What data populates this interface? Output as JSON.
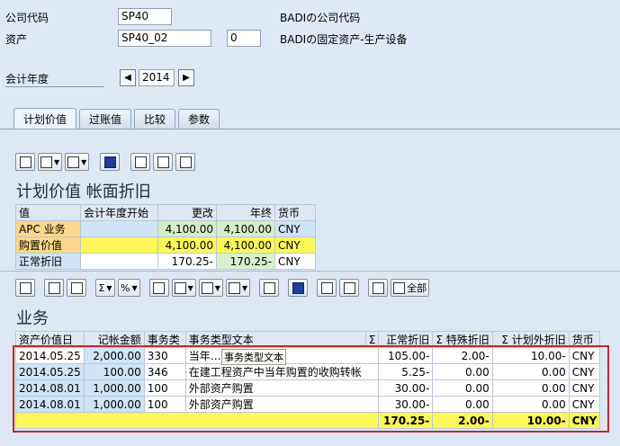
{
  "header": {
    "company_label": "公司代码",
    "company_value": "SP40",
    "company_badi": "BADIの公司代码",
    "asset_label": "资产",
    "asset_value": "SP40_02",
    "asset_sub": "0",
    "asset_badi": "BADIの固定资产-生产设备",
    "fy_label": "会计年度",
    "fy_value": "2014"
  },
  "tabs": [
    "计划价值",
    "过账值",
    "比较",
    "参数"
  ],
  "valuation": {
    "title": "计划价值 帐面折旧",
    "columns": [
      "值",
      "会计年度开始",
      "更改",
      "年终",
      "货币"
    ],
    "rows": [
      [
        "APC 业务",
        "",
        "4,100.00",
        "4,100.00",
        "CNY"
      ],
      [
        "购置价值",
        "",
        "4,100.00",
        "4,100.00",
        "CNY"
      ],
      [
        "正常折旧",
        "",
        "170.25-",
        "170.25-",
        "CNY"
      ]
    ]
  },
  "toolbar2": {
    "all_label": "全部"
  },
  "transactions": {
    "title": "业务",
    "columns": [
      "资产价值日",
      "记帐金额",
      "事务类",
      "事务类型文本",
      "Σ",
      "正常折旧",
      "Σ 特殊折旧",
      "Σ 计划外折旧",
      "货币"
    ],
    "rows": [
      [
        "2014.05.25",
        "2,000.00",
        "330",
        "当年…",
        "105.00-",
        "2.00-",
        "10.00-",
        "CNY"
      ],
      [
        "2014.05.25",
        "100.00",
        "346",
        "在建工程资产中当年购置的收购转帐",
        "5.25-",
        "0.00",
        "0.00",
        "CNY"
      ],
      [
        "2014.08.01",
        "1,000.00",
        "100",
        "外部资产购置",
        "30.00-",
        "0.00",
        "0.00",
        "CNY"
      ],
      [
        "2014.08.01",
        "1,000.00",
        "100",
        "外部资产购置",
        "30.00-",
        "0.00",
        "0.00",
        "CNY"
      ]
    ],
    "totals": {
      "normal": "170.25-",
      "special": "2.00-",
      "unplanned": "10.00-",
      "currency": "CNY"
    },
    "tooltip": "事务类型文本"
  }
}
